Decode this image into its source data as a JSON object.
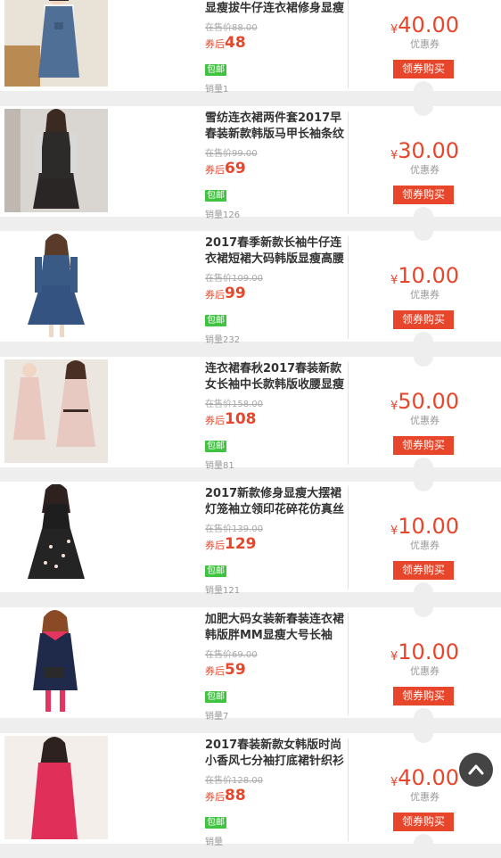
{
  "labels": {
    "orig_prefix": "在售价",
    "after_prefix": "券后",
    "free_shipping": "包邮",
    "sales_prefix": "销量",
    "currency": "¥",
    "coupon_label": "优惠券",
    "buy_button": "领券购买"
  },
  "products": [
    {
      "title": "春装新款韩版牛仔长袖修身显瘦拔牛仔连衣裙修身显瘦包臀裙",
      "orig": "88.00",
      "after": "48",
      "sales": "1",
      "coupon": "40.00",
      "img": "denim-pinafore-dress"
    },
    {
      "title": "雪纺连衣裙两件套2017早春装新款韩版马甲长袖条纹",
      "orig": "99.00",
      "after": "69",
      "sales": "126",
      "coupon": "30.00",
      "img": "chiffon-two-piece-dress"
    },
    {
      "title": "2017春季新款长袖牛仔连衣裙短裙大码韩版显瘦高腰",
      "orig": "109.00",
      "after": "99",
      "sales": "232",
      "coupon": "10.00",
      "img": "denim-shirt-dress"
    },
    {
      "title": "连衣裙春秋2017春装新款女长袖中长款韩版收腰显瘦",
      "orig": "158.00",
      "after": "108",
      "sales": "81",
      "coupon": "50.00",
      "img": "pink-midi-dress"
    },
    {
      "title": "2017新款修身显瘦大摆裙灯笼袖立领印花碎花仿真丝",
      "orig": "139.00",
      "after": "129",
      "sales": "121",
      "coupon": "10.00",
      "img": "floral-print-dress"
    },
    {
      "title": "加肥大码女装新春装连衣裙 韩版胖MM显瘦大号长袖",
      "orig": "69.00",
      "after": "59",
      "sales": "7",
      "coupon": "10.00",
      "img": "navy-plus-size-dress"
    },
    {
      "title": "2017春装新款女韩版时尚小香风七分袖打底裙针织衫",
      "orig": "128.00",
      "after": "88",
      "sales": "",
      "coupon": "40.00",
      "img": "red-knit-dress"
    }
  ],
  "colors": {
    "accent": "#e8462b",
    "free_badge": "#3ec43e",
    "page_bg": "#eeeeee"
  },
  "back_to_top_icon": "chevron-up-icon"
}
